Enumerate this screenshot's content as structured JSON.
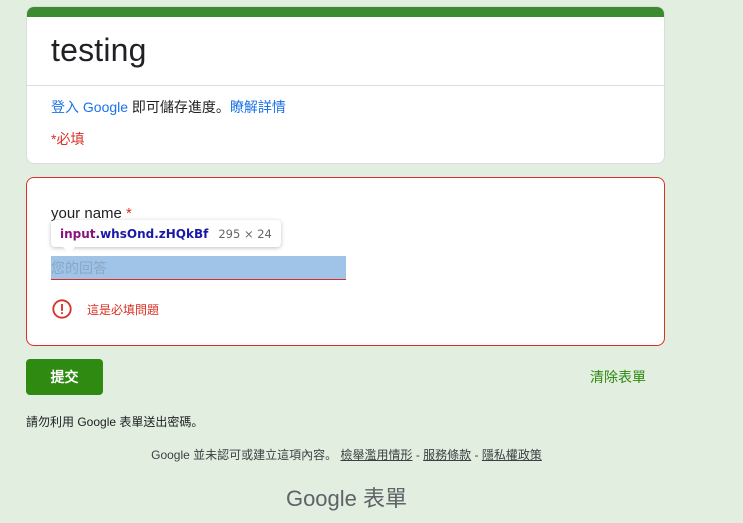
{
  "form": {
    "title": "testing",
    "signin_link": "登入 Google",
    "signin_text": " 即可儲存進度。",
    "learn_more": "瞭解詳情",
    "required_note": "*必填"
  },
  "question": {
    "label": "your name",
    "required_mark": "*",
    "placeholder": "您的回答",
    "value": "",
    "error_icon": "error-circle-icon",
    "error_text": "這是必填問題"
  },
  "inspector_tooltip": {
    "tag": "input",
    "classes": ".whsOnd.zHQkBf",
    "dimensions": "295 × 24"
  },
  "actions": {
    "submit_label": "提交",
    "clear_label": "清除表單"
  },
  "footer": {
    "password_note": "請勿利用 Google 表單送出密碼。",
    "disclaimer_text": "Google 並未認可或建立這項內容。",
    "report_abuse": "檢舉濫用情形",
    "separator": " - ",
    "terms": "服務條款",
    "privacy": "隱私權政策",
    "brand_google": "Google",
    "brand_product": "表單"
  },
  "colors": {
    "theme_band": "#3d8b2f",
    "background": "#e2eee0",
    "error": "#d93025",
    "link": "#1a73e8",
    "submit": "#2e8a10",
    "input_highlight": "#9fc4e7"
  }
}
